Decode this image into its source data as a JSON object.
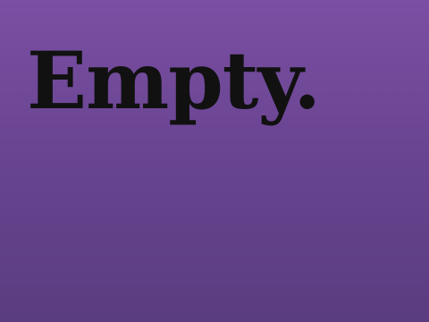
{
  "message": "Empty.",
  "colors": {
    "background_top": "#7b4fa3",
    "background_bottom": "#5a3c80",
    "text": "#111111"
  }
}
